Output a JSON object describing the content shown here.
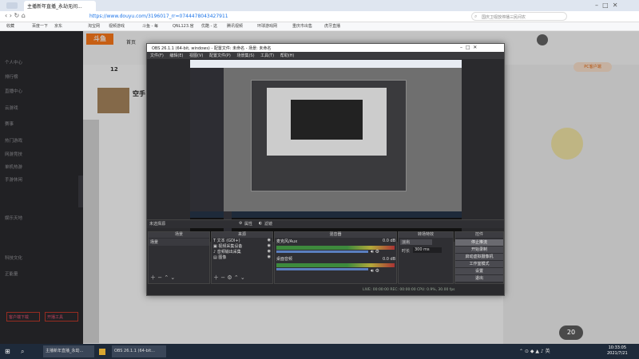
{
  "browser": {
    "tab_title": "主播新年直播_永劫无间...",
    "url": "https://www.douyu.com/3196017_rr=0744478043427911",
    "search_placeholder": "国庆卫视放停播三民间农",
    "bookmarks": [
      "收藏",
      "百度一下",
      "京东",
      "淘宝网",
      "视频游戏",
      "斗鱼 - 每",
      "QNL123.官",
      "优酷 - 这",
      "腾讯视频",
      "环球游戏网",
      "重庆市出售",
      "虎牙直播"
    ]
  },
  "page": {
    "logo": "斗鱼",
    "nav_home": "首页",
    "left_nav": [
      "个人中心",
      "排行榜",
      "直播中心",
      "云游戏",
      "赛事",
      "热门游戏",
      "网游竞技",
      "单机热游",
      "手游休闲",
      "娱乐天地",
      "科技文化",
      "正能量"
    ],
    "banner_title": "空手",
    "side_label": "PC客户端",
    "follow_count": "12",
    "bottom_btns": [
      "客户端下载",
      "开播工具"
    ]
  },
  "obs": {
    "title": "OBS 26.1.1 (64-bit, windows) - 配置文件: 未命名 - 场景: 未命名",
    "menu": [
      "文件(F)",
      "编辑(E)",
      "视图(V)",
      "配置文件(P)",
      "场景集(S)",
      "工具(T)",
      "帮助(H)"
    ],
    "no_source": "未选择源",
    "props_btn": "属性",
    "filter_btn": "滤镜",
    "docks": {
      "scenes": "场景",
      "sources": "来源",
      "mixer": "混音器",
      "transitions": "转场特效",
      "controls": "控件"
    },
    "scene_items": [
      "场景"
    ],
    "source_items": [
      "文本 (GDI+)",
      "视频采集设备",
      "音频输出采集",
      "图像"
    ],
    "mixer_items": [
      {
        "name": "麦克风/Aux",
        "db": "0.0 dB"
      },
      {
        "name": "桌面音频",
        "db": "0.0 dB"
      }
    ],
    "transition_type": "淡出",
    "duration_label": "时长",
    "duration_value": "300 ms",
    "controls": [
      "停止推流",
      "开始录制",
      "启动虚拟摄像机",
      "工作室模式",
      "设置",
      "退出"
    ],
    "status": "LIVE: 00:00:00   REC: 00:00:00   CPU: 0.9%, 30.00 fps"
  },
  "taskbar": {
    "items": [
      "主播新年直播_永劫...",
      "OBS 26.1.1 (64-bit..."
    ],
    "time": "10:33:05",
    "date": "2021/7/21",
    "badge": "20"
  }
}
